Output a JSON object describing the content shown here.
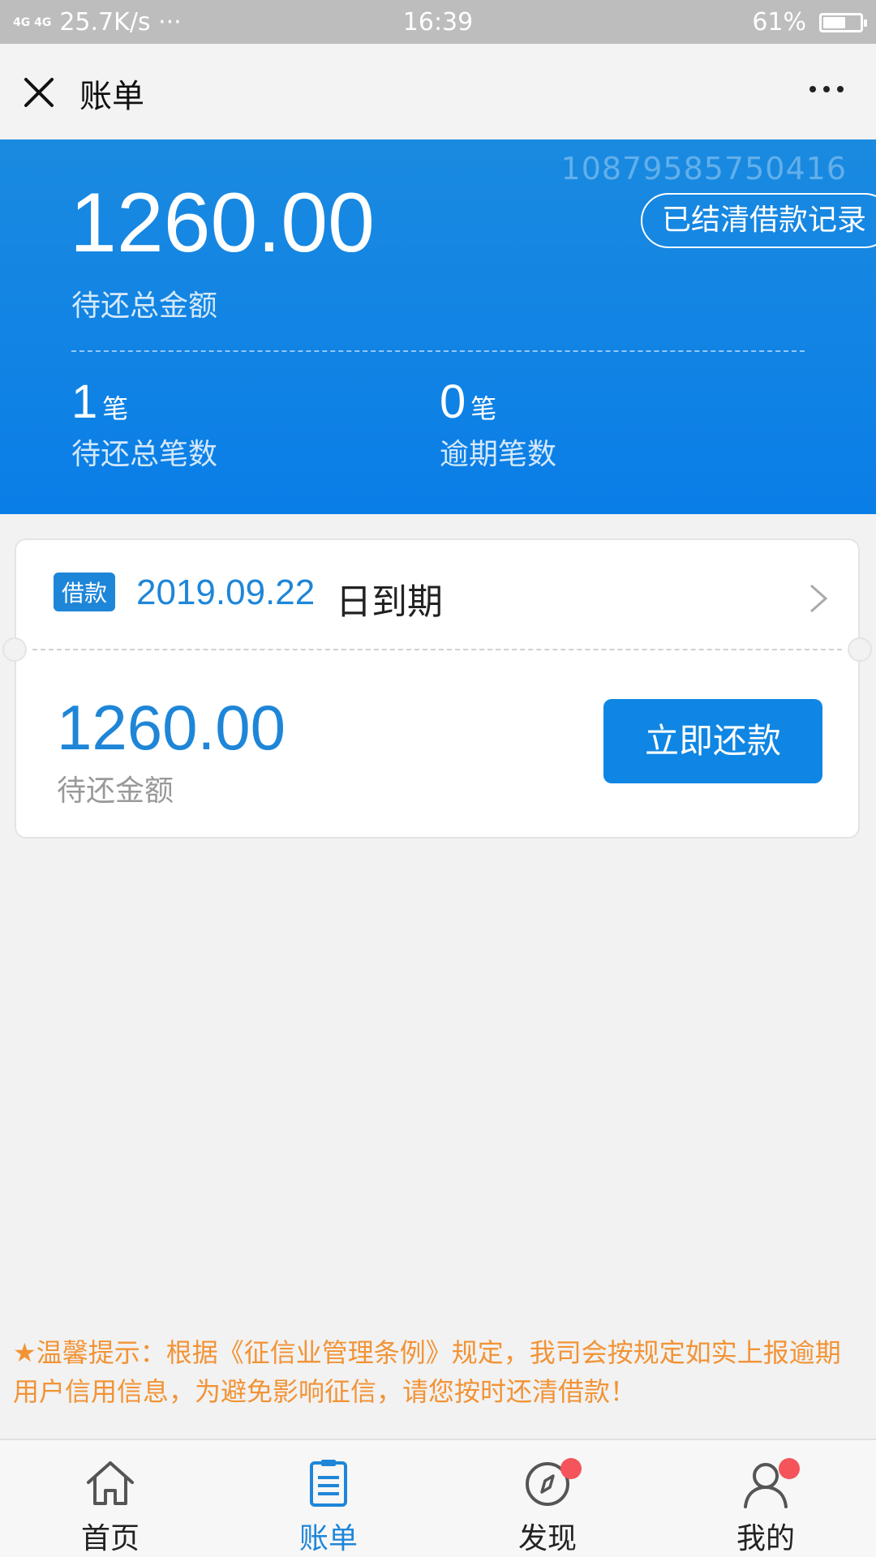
{
  "status_bar": {
    "signal_text": "4G 4G",
    "network_speed": "25.7K/s ···",
    "time": "16:39",
    "battery_percent_text": "61%",
    "battery_level": 0.61
  },
  "title_bar": {
    "title": "账单"
  },
  "summary": {
    "account_number": "10879585750416",
    "settled_records_label": "已结清借款记录",
    "total_amount": "1260.00",
    "total_amount_label": "待还总金额",
    "pending_count": "1",
    "pending_unit": "笔",
    "pending_label": "待还总笔数",
    "overdue_count": "0",
    "overdue_unit": "笔",
    "overdue_label": "逾期笔数"
  },
  "loan_card": {
    "tag": "借款",
    "due_date": "2019.09.22",
    "due_suffix": "日到期",
    "amount": "1260.00",
    "amount_label": "待还金额",
    "repay_label": "立即还款"
  },
  "notice": {
    "text": "★温馨提示：根据《征信业管理条例》规定，我司会按规定如实上报逾期用户信用信息，为避免影响征信，请您按时还清借款！"
  },
  "tab_bar": {
    "tabs": [
      {
        "label": "首页",
        "icon": "home-icon",
        "active": false
      },
      {
        "label": "账单",
        "icon": "bill-icon",
        "active": true
      },
      {
        "label": "发现",
        "icon": "compass-icon",
        "active": false,
        "badge": true
      },
      {
        "label": "我的",
        "icon": "user-icon",
        "active": false,
        "badge": true
      }
    ]
  },
  "colors": {
    "primary": "#0a7ee7",
    "notice": "#f29335",
    "badge": "#f4545a"
  }
}
